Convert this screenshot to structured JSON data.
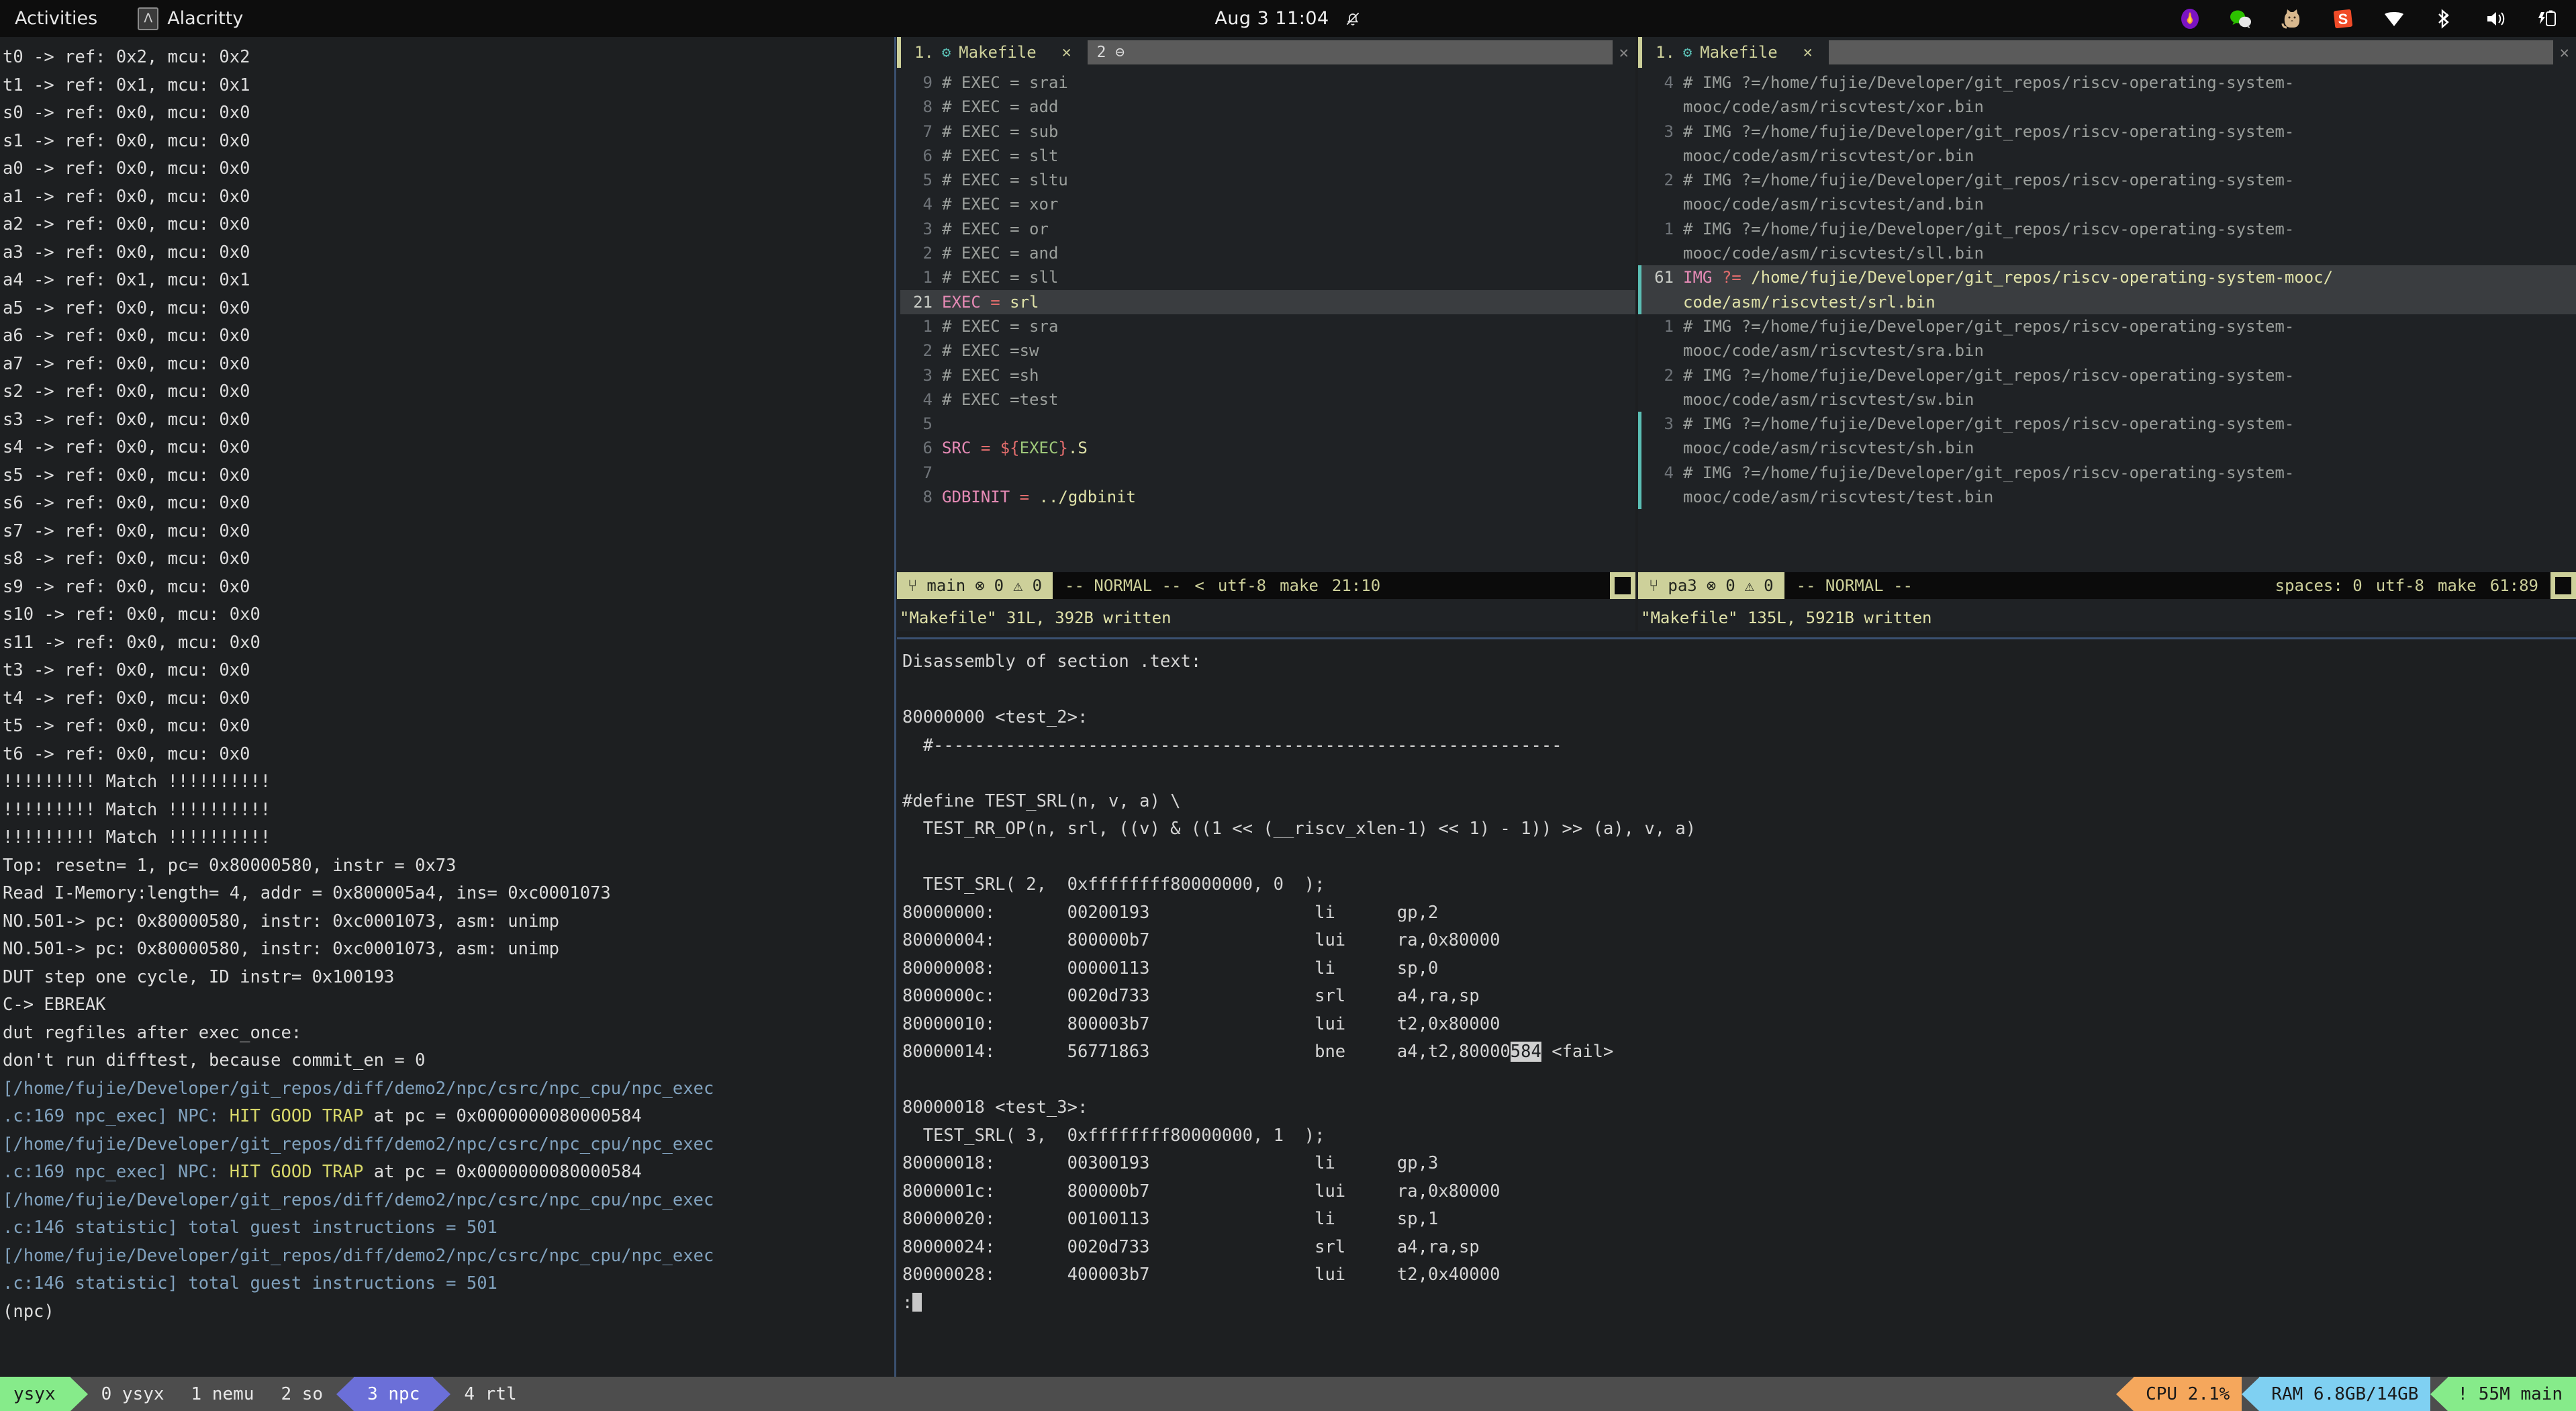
{
  "topbar": {
    "activities": "Activities",
    "app_name": "Alacritty",
    "clock": "Aug 3  11:04",
    "icons": [
      "alacritty-icon",
      "bell-off-icon",
      "flame-app-icon",
      "wechat-icon",
      "cat-icon",
      "sogou-icon",
      "wifi-icon",
      "bluetooth-icon",
      "volume-icon",
      "battery-charging-icon"
    ]
  },
  "left_terminal": {
    "lines": [
      {
        "t": "t0 -> ref: 0x2, mcu: 0x2"
      },
      {
        "t": "t1 -> ref: 0x1, mcu: 0x1"
      },
      {
        "t": "s0 -> ref: 0x0, mcu: 0x0"
      },
      {
        "t": "s1 -> ref: 0x0, mcu: 0x0"
      },
      {
        "t": "a0 -> ref: 0x0, mcu: 0x0"
      },
      {
        "t": "a1 -> ref: 0x0, mcu: 0x0"
      },
      {
        "t": "a2 -> ref: 0x0, mcu: 0x0"
      },
      {
        "t": "a3 -> ref: 0x0, mcu: 0x0"
      },
      {
        "t": "a4 -> ref: 0x1, mcu: 0x1"
      },
      {
        "t": "a5 -> ref: 0x0, mcu: 0x0"
      },
      {
        "t": "a6 -> ref: 0x0, mcu: 0x0"
      },
      {
        "t": "a7 -> ref: 0x0, mcu: 0x0"
      },
      {
        "t": "s2 -> ref: 0x0, mcu: 0x0"
      },
      {
        "t": "s3 -> ref: 0x0, mcu: 0x0"
      },
      {
        "t": "s4 -> ref: 0x0, mcu: 0x0"
      },
      {
        "t": "s5 -> ref: 0x0, mcu: 0x0"
      },
      {
        "t": "s6 -> ref: 0x0, mcu: 0x0"
      },
      {
        "t": "s7 -> ref: 0x0, mcu: 0x0"
      },
      {
        "t": "s8 -> ref: 0x0, mcu: 0x0"
      },
      {
        "t": "s9 -> ref: 0x0, mcu: 0x0"
      },
      {
        "t": "s10 -> ref: 0x0, mcu: 0x0"
      },
      {
        "t": "s11 -> ref: 0x0, mcu: 0x0"
      },
      {
        "t": "t3 -> ref: 0x0, mcu: 0x0"
      },
      {
        "t": "t4 -> ref: 0x0, mcu: 0x0"
      },
      {
        "t": "t5 -> ref: 0x0, mcu: 0x0"
      },
      {
        "t": "t6 -> ref: 0x0, mcu: 0x0"
      },
      {
        "t": "!!!!!!!!! Match !!!!!!!!!!"
      },
      {
        "t": "!!!!!!!!! Match !!!!!!!!!!"
      },
      {
        "t": "!!!!!!!!! Match !!!!!!!!!!"
      },
      {
        "t": "Top: resetn= 1, pc= 0x80000580, instr = 0x73"
      },
      {
        "t": "Read I-Memory:length= 4, addr = 0x800005a4, ins= 0xc0001073"
      },
      {
        "t": "NO.501-> pc: 0x80000580, instr: 0xc0001073, asm: unimp"
      },
      {
        "t": "NO.501-> pc: 0x80000580, instr: 0xc0001073, asm: unimp"
      },
      {
        "t": "DUT step one cycle, ID instr= 0x100193"
      },
      {
        "t": "C-> EBREAK"
      },
      {
        "t": "dut regfiles after exec_once:"
      },
      {
        "t": "don't run difftest, because commit_en = 0"
      },
      {
        "t": "[/home/fujie/Developer/git_repos/diff/demo2/npc/csrc/npc_cpu/npc_exec",
        "c": "blue"
      },
      {
        "t": ".c:169 npc_exec] NPC: ",
        "c": "blue",
        "hl": "HIT GOOD TRAP",
        "tail": " at pc = 0x0000000080000584"
      },
      {
        "t": "[/home/fujie/Developer/git_repos/diff/demo2/npc/csrc/npc_cpu/npc_exec",
        "c": "blue"
      },
      {
        "t": ".c:169 npc_exec] NPC: ",
        "c": "blue",
        "hl": "HIT GOOD TRAP",
        "tail": " at pc = 0x0000000080000584"
      },
      {
        "t": "[/home/fujie/Developer/git_repos/diff/demo2/npc/csrc/npc_cpu/npc_exec",
        "c": "blue"
      },
      {
        "t": ".c:146 statistic] total guest instructions = 501",
        "c": "blue"
      },
      {
        "t": "[/home/fujie/Developer/git_repos/diff/demo2/npc/csrc/npc_cpu/npc_exec",
        "c": "blue"
      },
      {
        "t": ".c:146 statistic] total guest instructions = 501",
        "c": "blue"
      },
      {
        "t": "(npc)"
      }
    ]
  },
  "vim_left": {
    "tab": {
      "number": "1.",
      "gear": "⚙",
      "name": "Makefile",
      "close": "✕"
    },
    "tab2": {
      "label": "2 ⊖",
      "close": "✕"
    },
    "lines": [
      {
        "n": "9",
        "txt": "# EXEC = srai",
        "c": "comment"
      },
      {
        "n": "8",
        "txt": "# EXEC = add",
        "c": "comment"
      },
      {
        "n": "7",
        "txt": "# EXEC = sub",
        "c": "comment"
      },
      {
        "n": "6",
        "txt": "# EXEC = slt",
        "c": "comment"
      },
      {
        "n": "5",
        "txt": "# EXEC = sltu",
        "c": "comment"
      },
      {
        "n": "4",
        "txt": "# EXEC = xor",
        "c": "comment"
      },
      {
        "n": "3",
        "txt": "# EXEC = or",
        "c": "comment"
      },
      {
        "n": "2",
        "txt": "# EXEC = and",
        "c": "comment"
      },
      {
        "n": "1",
        "txt": "# EXEC = sll",
        "c": "comment"
      },
      {
        "n": "21",
        "cursor": true,
        "var": "EXEC",
        "op": "=",
        "val": "srl"
      },
      {
        "n": "1",
        "txt": "# EXEC = sra",
        "c": "comment"
      },
      {
        "n": "2",
        "txt": "# EXEC =sw",
        "c": "comment"
      },
      {
        "n": "3",
        "txt": "# EXEC =sh",
        "c": "comment"
      },
      {
        "n": "4",
        "txt": "# EXEC =test",
        "c": "comment"
      },
      {
        "n": "5",
        "txt": "",
        "c": "comment"
      },
      {
        "n": "6",
        "var": "SRC",
        "op": "=",
        "val_green": "${EXEC}.S"
      },
      {
        "n": "7",
        "txt": "",
        "c": "comment"
      },
      {
        "n": "8",
        "var": "GDBINIT",
        "op": "=",
        "val": "../gdbinit"
      }
    ],
    "status": {
      "branch_icon": "⑂",
      "branch": "main",
      "err_icon": "⊗",
      "errors": "0",
      "warn_icon": "⚠",
      "warnings": "0",
      "mode": "-- NORMAL --",
      "extra": "<",
      "encoding": "utf-8",
      "filetype": "make",
      "position": "21:10"
    },
    "message": "\"Makefile\" 31L, 392B written"
  },
  "vim_right": {
    "tab": {
      "number": "1.",
      "gear": "⚙",
      "name": "Makefile",
      "close": "✕"
    },
    "tab_close_right": "✕",
    "lines": [
      {
        "n": "4",
        "txt": "# IMG ?=/home/fujie/Developer/git_repos/riscv-operating-system-",
        "wrap": "mooc/code/asm/riscvtest/xor.bin",
        "c": "comment"
      },
      {
        "n": "3",
        "txt": "# IMG ?=/home/fujie/Developer/git_repos/riscv-operating-system-",
        "wrap": "mooc/code/asm/riscvtest/or.bin",
        "c": "comment"
      },
      {
        "n": "2",
        "txt": "# IMG ?=/home/fujie/Developer/git_repos/riscv-operating-system-",
        "wrap": "mooc/code/asm/riscvtest/and.bin",
        "c": "comment"
      },
      {
        "n": "1",
        "txt": "# IMG ?=/home/fujie/Developer/git_repos/riscv-operating-system-",
        "wrap": "mooc/code/asm/riscvtest/sll.bin",
        "c": "comment"
      },
      {
        "n": "61",
        "cursor": true,
        "teal": true,
        "var": "IMG",
        "op": "?=",
        "val": "/home/fujie/Developer/git_repos/riscv-operating-system-mooc/",
        "wrap_val": "code/asm/riscvtest/srl.bin"
      },
      {
        "n": "1",
        "txt": "# IMG ?=/home/fujie/Developer/git_repos/riscv-operating-system-",
        "wrap": "mooc/code/asm/riscvtest/sra.bin",
        "c": "comment"
      },
      {
        "n": "2",
        "txt": "# IMG ?=/home/fujie/Developer/git_repos/riscv-operating-system-",
        "wrap": "mooc/code/asm/riscvtest/sw.bin",
        "c": "comment"
      },
      {
        "n": "3",
        "teal": true,
        "txt": "# IMG ?=/home/fujie/Developer/git_repos/riscv-operating-system-",
        "wrap": "mooc/code/asm/riscvtest/sh.bin",
        "c": "comment"
      },
      {
        "n": "4",
        "teal": true,
        "txt": "# IMG ?=/home/fujie/Developer/git_repos/riscv-operating-system-",
        "wrap": "mooc/code/asm/riscvtest/test.bin",
        "c": "comment"
      }
    ],
    "status": {
      "branch_icon": "⑂",
      "branch": "pa3",
      "err_icon": "⊗",
      "errors": "0",
      "warn_icon": "⚠",
      "warnings": "0",
      "mode": "-- NORMAL --",
      "spaces": "spaces: 0",
      "encoding": "utf-8",
      "filetype": "make",
      "position": "61:89"
    },
    "message": "\"Makefile\" 135L, 5921B written"
  },
  "disassembly": {
    "lines": [
      {
        "t": "Disassembly of section .text:"
      },
      {
        "t": ""
      },
      {
        "t": "80000000 <test_2>:"
      },
      {
        "t": "  #-------------------------------------------------------------"
      },
      {
        "t": ""
      },
      {
        "t": "#define TEST_SRL(n, v, a) \\"
      },
      {
        "t": "  TEST_RR_OP(n, srl, ((v) & ((1 << (__riscv_xlen-1) << 1) - 1)) >> (a), v, a)"
      },
      {
        "t": ""
      },
      {
        "t": "  TEST_SRL( 2,  0xffffffff80000000, 0  );"
      },
      {
        "t": "80000000:       00200193                li      gp,2"
      },
      {
        "t": "80000004:       800000b7                lui     ra,0x80000"
      },
      {
        "t": "80000008:       00000113                li      sp,0"
      },
      {
        "t": "8000000c:       0020d733                srl     a4,ra,sp"
      },
      {
        "t": "80000010:       800003b7                lui     t2,0x80000"
      },
      {
        "t": "80000014:       56771863                bne     a4,t2,80000",
        "hl": "584",
        "tail": " <fail>"
      },
      {
        "t": ""
      },
      {
        "t": "80000018 <test_3>:"
      },
      {
        "t": "  TEST_SRL( 3,  0xffffffff80000000, 1  );"
      },
      {
        "t": "80000018:       00300193                li      gp,3"
      },
      {
        "t": "8000001c:       800000b7                lui     ra,0x80000"
      },
      {
        "t": "80000020:       00100113                li      sp,1"
      },
      {
        "t": "80000024:       0020d733                srl     a4,ra,sp"
      },
      {
        "t": "80000028:       400003b7                lui     t2,0x40000"
      },
      {
        "t": ":",
        "cursor": true
      }
    ]
  },
  "tmux": {
    "session": "ysyx",
    "windows": [
      {
        "label": "0 ysyx",
        "active": false
      },
      {
        "label": "1 nemu",
        "active": false
      },
      {
        "label": "2 so",
        "active": false
      },
      {
        "label": "3 npc",
        "active": true
      },
      {
        "label": "4 rtl",
        "active": false
      }
    ],
    "cpu": "CPU  2.1%",
    "ram": "RAM 6.8GB/14GB",
    "git": "! 55M main",
    "colors": {
      "session_bg": "#86eb8a",
      "active_window_bg": "#6b6fd8",
      "cpu_bg": "#f5a75c",
      "ram_bg": "#7fd0f2",
      "git_bg": "#86eb8a",
      "bar_bg": "#4d4d4d"
    }
  }
}
